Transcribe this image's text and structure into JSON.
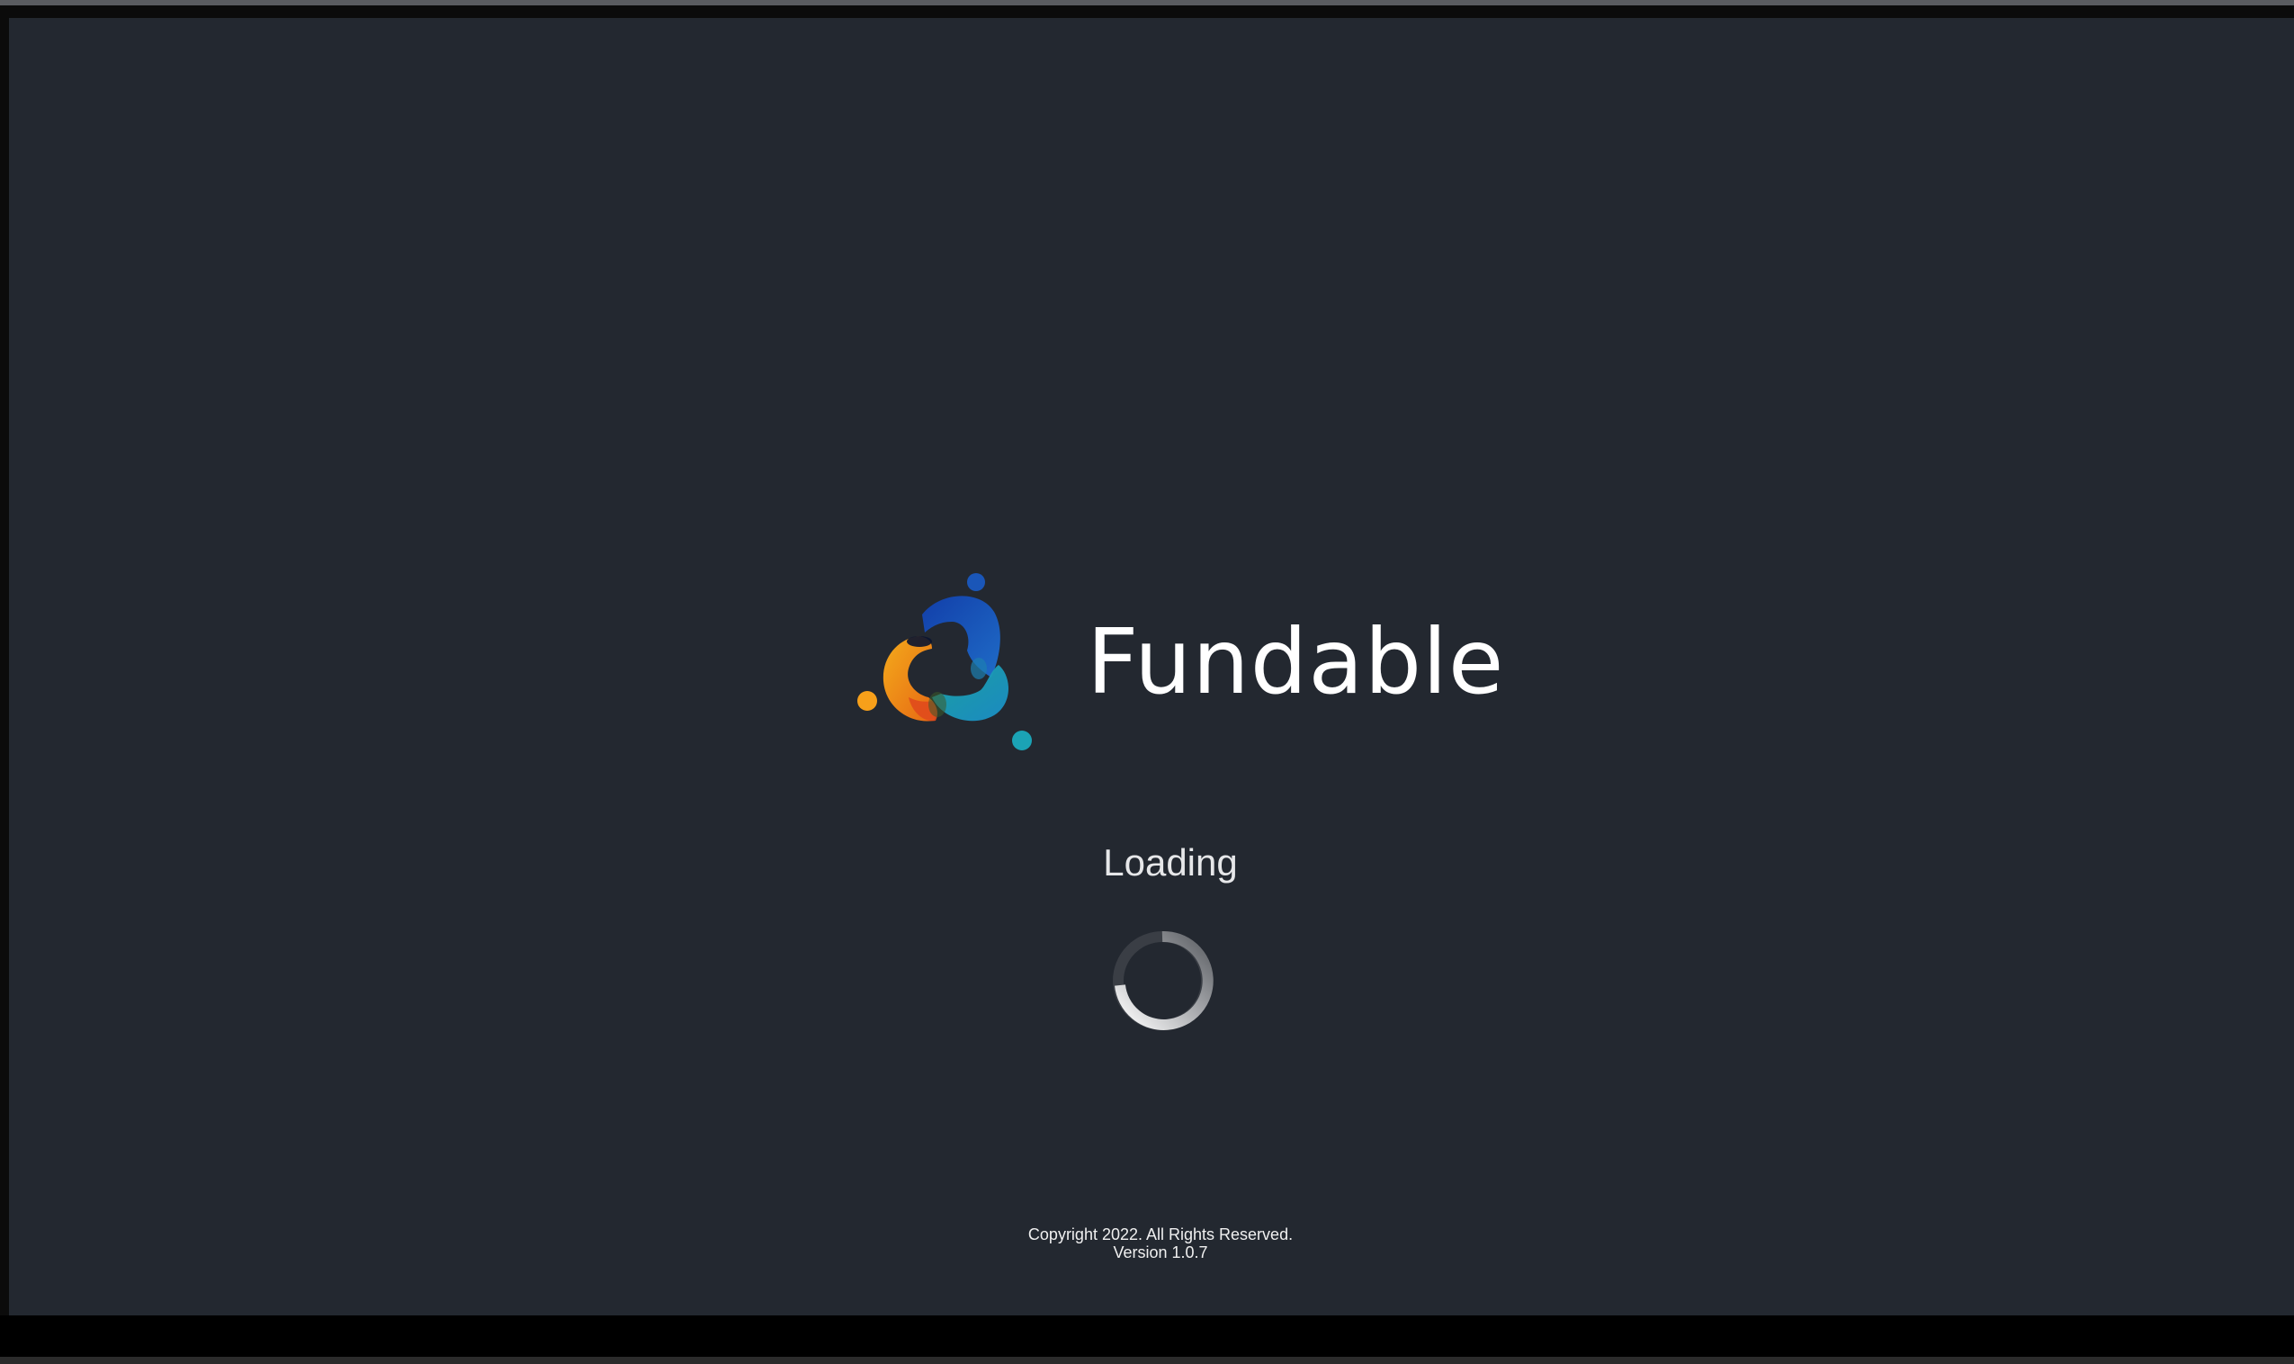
{
  "app": {
    "name": "Fundable",
    "logo_icon": "fundable-logo-icon"
  },
  "status": {
    "loading_text": "Loading",
    "spinner_icon": "loading-spinner-icon"
  },
  "footer": {
    "copyright": "Copyright 2022. All Rights Reserved.",
    "version": "Version 1.0.7"
  },
  "colors": {
    "background": "#232830",
    "text": "#ffffff",
    "logo_orange": "#f7941d",
    "logo_red": "#e8491d",
    "logo_blue": "#1a56b8",
    "logo_teal": "#1ba3b5"
  }
}
